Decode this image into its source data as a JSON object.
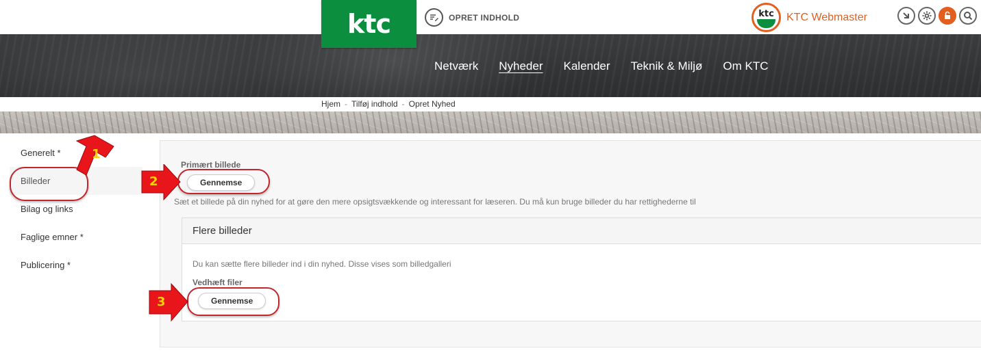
{
  "header": {
    "logo_text": "ktc",
    "create_label": "OPRET INDHOLD",
    "user_name": "KTC Webmaster",
    "avatar_text": "ktc"
  },
  "nav": {
    "items": [
      {
        "label": "Netværk"
      },
      {
        "label": "Nyheder",
        "active": true
      },
      {
        "label": "Kalender"
      },
      {
        "label": "Teknik & Miljø"
      },
      {
        "label": "Om KTC"
      }
    ]
  },
  "breadcrumb": {
    "items": [
      "Hjem",
      "Tilføj indhold",
      "Opret Nyhed"
    ],
    "separator": "-"
  },
  "sidebar": {
    "items": [
      {
        "label": "Generelt *"
      },
      {
        "label": "Billeder",
        "active": true
      },
      {
        "label": "Bilag og links"
      },
      {
        "label": "Faglige emner *"
      },
      {
        "label": "Publicering *"
      }
    ]
  },
  "main": {
    "primary_image_label": "Primært billede",
    "browse_label": "Gennemse",
    "primary_image_help": "Sæt et billede på din nyhed for at gøre den mere opsigtsvækkende og interessant for læseren. Du må kun bruge billeder du har rettighederne til",
    "more_images": {
      "title": "Flere billeder",
      "help": "Du kan sætte flere billeder ind i din nyhed. Disse vises som billedgalleri",
      "attach_label": "Vedhæft filer",
      "browse_label": "Gennemse"
    }
  },
  "annotations": {
    "callouts": [
      "1",
      "2",
      "3"
    ],
    "arrow_color": "#e8161b",
    "ring_color": "#c0262c"
  },
  "colors": {
    "brand_green": "#0b8f3e",
    "accent_orange": "#e35f1f"
  }
}
